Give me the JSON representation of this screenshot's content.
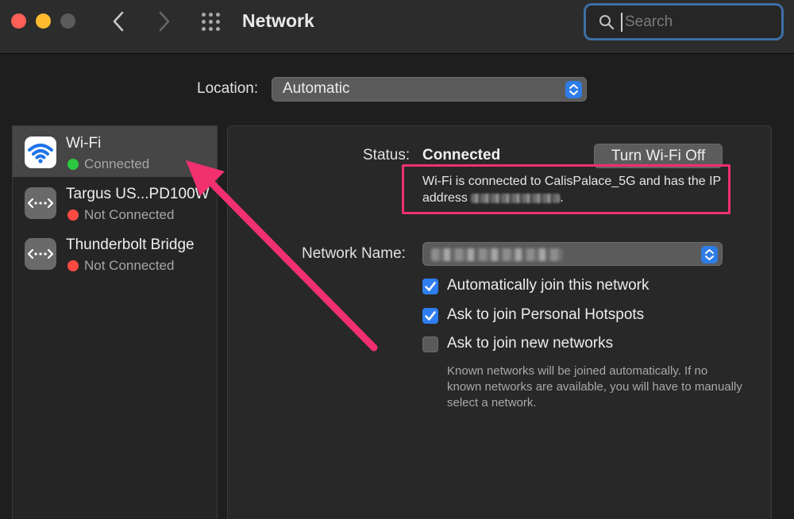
{
  "window": {
    "title": "Network",
    "search_placeholder": "Search"
  },
  "location": {
    "label": "Location:",
    "value": "Automatic"
  },
  "sidebar": {
    "items": [
      {
        "name": "Wi-Fi",
        "status": "Connected",
        "status_color": "#2bc840",
        "icon": "wifi-icon",
        "selected": true
      },
      {
        "name": "Targus US...PD100W",
        "status": "Not Connected",
        "status_color": "#ff4a42",
        "icon": "ethernet-icon",
        "selected": false
      },
      {
        "name": "Thunderbolt Bridge",
        "status": "Not Connected",
        "status_color": "#ff4a42",
        "icon": "ethernet-icon",
        "selected": false
      }
    ]
  },
  "main": {
    "status_label": "Status:",
    "status_value": "Connected",
    "turn_off_button": "Turn Wi-Fi Off",
    "status_desc_before": "Wi-Fi is connected to CalisPalace_5G and has the IP address ",
    "status_desc_after": ".",
    "network_name_label": "Network Name:",
    "checkboxes": [
      {
        "label": "Automatically join this network",
        "checked": true
      },
      {
        "label": "Ask to join Personal Hotspots",
        "checked": true
      },
      {
        "label": "Ask to join new networks",
        "checked": false
      }
    ],
    "help_text": "Known networks will be joined automatically. If no known networks are available, you will have to manually select a network."
  },
  "colors": {
    "accent": "#2f7ef0",
    "annotation": "#f0306f"
  }
}
